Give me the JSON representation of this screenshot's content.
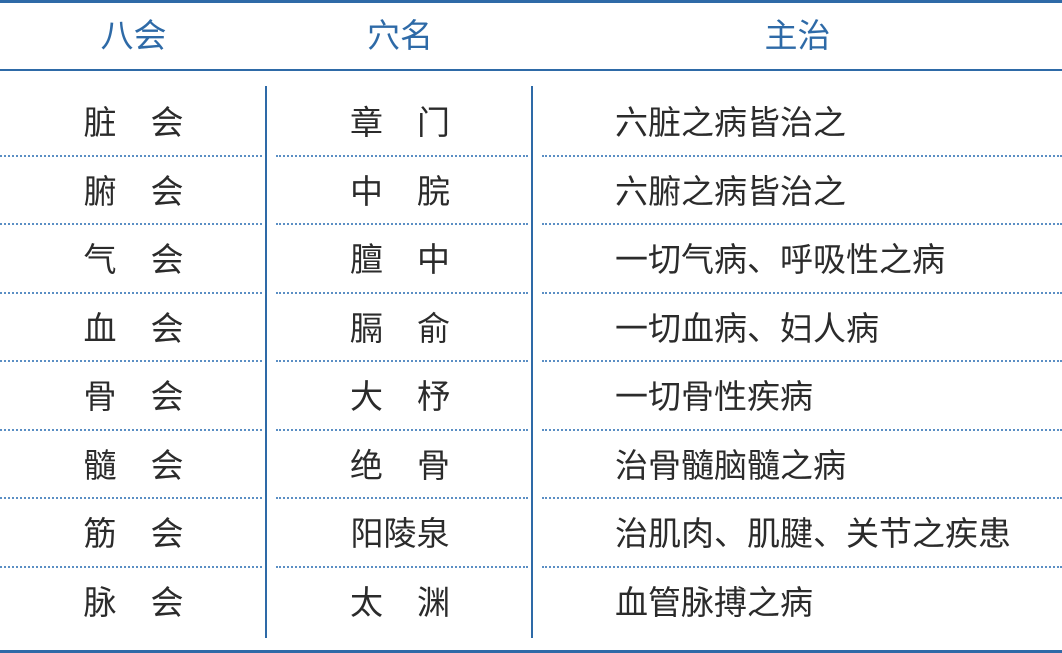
{
  "table": {
    "headers": [
      "八会",
      "穴名",
      "主治"
    ],
    "rows": [
      {
        "hui": "脏会",
        "point": "章门",
        "indication": "六脏之病皆治之"
      },
      {
        "hui": "腑会",
        "point": "中脘",
        "indication": "六腑之病皆治之"
      },
      {
        "hui": "气会",
        "point": "膻中",
        "indication": "一切气病、呼吸性之病"
      },
      {
        "hui": "血会",
        "point": "膈俞",
        "indication": "一切血病、妇人病"
      },
      {
        "hui": "骨会",
        "point": "大杼",
        "indication": "一切骨性疾病"
      },
      {
        "hui": "髓会",
        "point": "绝骨",
        "indication": "治骨髓脑髓之病"
      },
      {
        "hui": "筋会",
        "point": "阳陵泉",
        "indication": "治肌肉、肌腱、关节之疾患"
      },
      {
        "hui": "脉会",
        "point": "太渊",
        "indication": "血管脉搏之病"
      }
    ]
  },
  "colors": {
    "accent": "#2e6aa7",
    "text": "#2b2b2b",
    "dotted_rule": "#5b8fc4"
  }
}
